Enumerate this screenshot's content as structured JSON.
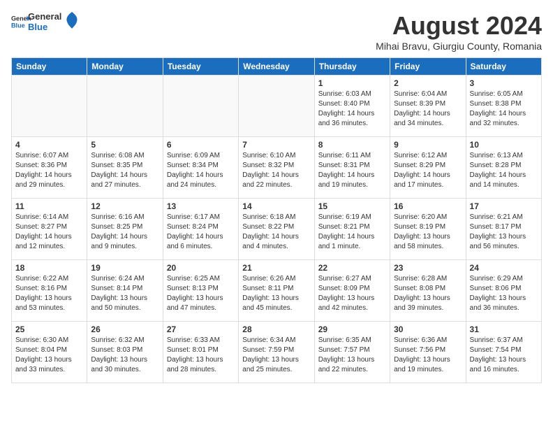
{
  "header": {
    "logo_line1": "General",
    "logo_line2": "Blue",
    "month_title": "August 2024",
    "location": "Mihai Bravu, Giurgiu County, Romania"
  },
  "days_of_week": [
    "Sunday",
    "Monday",
    "Tuesday",
    "Wednesday",
    "Thursday",
    "Friday",
    "Saturday"
  ],
  "weeks": [
    [
      {
        "day": "",
        "info": ""
      },
      {
        "day": "",
        "info": ""
      },
      {
        "day": "",
        "info": ""
      },
      {
        "day": "",
        "info": ""
      },
      {
        "day": "1",
        "info": "Sunrise: 6:03 AM\nSunset: 8:40 PM\nDaylight: 14 hours\nand 36 minutes."
      },
      {
        "day": "2",
        "info": "Sunrise: 6:04 AM\nSunset: 8:39 PM\nDaylight: 14 hours\nand 34 minutes."
      },
      {
        "day": "3",
        "info": "Sunrise: 6:05 AM\nSunset: 8:38 PM\nDaylight: 14 hours\nand 32 minutes."
      }
    ],
    [
      {
        "day": "4",
        "info": "Sunrise: 6:07 AM\nSunset: 8:36 PM\nDaylight: 14 hours\nand 29 minutes."
      },
      {
        "day": "5",
        "info": "Sunrise: 6:08 AM\nSunset: 8:35 PM\nDaylight: 14 hours\nand 27 minutes."
      },
      {
        "day": "6",
        "info": "Sunrise: 6:09 AM\nSunset: 8:34 PM\nDaylight: 14 hours\nand 24 minutes."
      },
      {
        "day": "7",
        "info": "Sunrise: 6:10 AM\nSunset: 8:32 PM\nDaylight: 14 hours\nand 22 minutes."
      },
      {
        "day": "8",
        "info": "Sunrise: 6:11 AM\nSunset: 8:31 PM\nDaylight: 14 hours\nand 19 minutes."
      },
      {
        "day": "9",
        "info": "Sunrise: 6:12 AM\nSunset: 8:29 PM\nDaylight: 14 hours\nand 17 minutes."
      },
      {
        "day": "10",
        "info": "Sunrise: 6:13 AM\nSunset: 8:28 PM\nDaylight: 14 hours\nand 14 minutes."
      }
    ],
    [
      {
        "day": "11",
        "info": "Sunrise: 6:14 AM\nSunset: 8:27 PM\nDaylight: 14 hours\nand 12 minutes."
      },
      {
        "day": "12",
        "info": "Sunrise: 6:16 AM\nSunset: 8:25 PM\nDaylight: 14 hours\nand 9 minutes."
      },
      {
        "day": "13",
        "info": "Sunrise: 6:17 AM\nSunset: 8:24 PM\nDaylight: 14 hours\nand 6 minutes."
      },
      {
        "day": "14",
        "info": "Sunrise: 6:18 AM\nSunset: 8:22 PM\nDaylight: 14 hours\nand 4 minutes."
      },
      {
        "day": "15",
        "info": "Sunrise: 6:19 AM\nSunset: 8:21 PM\nDaylight: 14 hours\nand 1 minute."
      },
      {
        "day": "16",
        "info": "Sunrise: 6:20 AM\nSunset: 8:19 PM\nDaylight: 13 hours\nand 58 minutes."
      },
      {
        "day": "17",
        "info": "Sunrise: 6:21 AM\nSunset: 8:17 PM\nDaylight: 13 hours\nand 56 minutes."
      }
    ],
    [
      {
        "day": "18",
        "info": "Sunrise: 6:22 AM\nSunset: 8:16 PM\nDaylight: 13 hours\nand 53 minutes."
      },
      {
        "day": "19",
        "info": "Sunrise: 6:24 AM\nSunset: 8:14 PM\nDaylight: 13 hours\nand 50 minutes."
      },
      {
        "day": "20",
        "info": "Sunrise: 6:25 AM\nSunset: 8:13 PM\nDaylight: 13 hours\nand 47 minutes."
      },
      {
        "day": "21",
        "info": "Sunrise: 6:26 AM\nSunset: 8:11 PM\nDaylight: 13 hours\nand 45 minutes."
      },
      {
        "day": "22",
        "info": "Sunrise: 6:27 AM\nSunset: 8:09 PM\nDaylight: 13 hours\nand 42 minutes."
      },
      {
        "day": "23",
        "info": "Sunrise: 6:28 AM\nSunset: 8:08 PM\nDaylight: 13 hours\nand 39 minutes."
      },
      {
        "day": "24",
        "info": "Sunrise: 6:29 AM\nSunset: 8:06 PM\nDaylight: 13 hours\nand 36 minutes."
      }
    ],
    [
      {
        "day": "25",
        "info": "Sunrise: 6:30 AM\nSunset: 8:04 PM\nDaylight: 13 hours\nand 33 minutes."
      },
      {
        "day": "26",
        "info": "Sunrise: 6:32 AM\nSunset: 8:03 PM\nDaylight: 13 hours\nand 30 minutes."
      },
      {
        "day": "27",
        "info": "Sunrise: 6:33 AM\nSunset: 8:01 PM\nDaylight: 13 hours\nand 28 minutes."
      },
      {
        "day": "28",
        "info": "Sunrise: 6:34 AM\nSunset: 7:59 PM\nDaylight: 13 hours\nand 25 minutes."
      },
      {
        "day": "29",
        "info": "Sunrise: 6:35 AM\nSunset: 7:57 PM\nDaylight: 13 hours\nand 22 minutes."
      },
      {
        "day": "30",
        "info": "Sunrise: 6:36 AM\nSunset: 7:56 PM\nDaylight: 13 hours\nand 19 minutes."
      },
      {
        "day": "31",
        "info": "Sunrise: 6:37 AM\nSunset: 7:54 PM\nDaylight: 13 hours\nand 16 minutes."
      }
    ]
  ]
}
